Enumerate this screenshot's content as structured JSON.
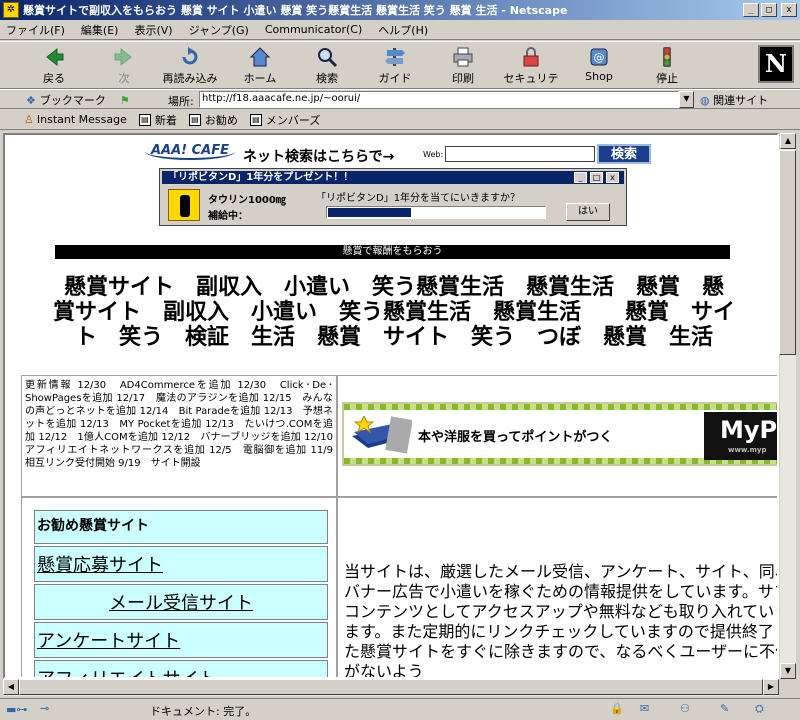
{
  "window": {
    "title": "懸賞サイトで副収入をもらおう 懸賞 サイト 小遣い 懸賞 笑う懸賞生活 懸賞生活 笑う 懸賞 生活 - Netscape",
    "minimize": "_",
    "maximize": "□",
    "close": "x"
  },
  "menu": [
    "ファイル(F)",
    "編集(E)",
    "表示(V)",
    "ジャンプ(G)",
    "Communicator(C)",
    "ヘルプ(H)"
  ],
  "toolbar": [
    {
      "label": "戻る",
      "icon": "back-icon"
    },
    {
      "label": "次",
      "icon": "forward-icon"
    },
    {
      "label": "再読み込み",
      "icon": "reload-icon"
    },
    {
      "label": "ホーム",
      "icon": "home-icon"
    },
    {
      "label": "検索",
      "icon": "search-icon"
    },
    {
      "label": "ガイド",
      "icon": "guide-icon"
    },
    {
      "label": "印刷",
      "icon": "print-icon"
    },
    {
      "label": "セキュリティ",
      "icon": "security-icon"
    },
    {
      "label": "Shop",
      "icon": "shop-icon"
    },
    {
      "label": "停止",
      "icon": "stop-icon"
    }
  ],
  "location": {
    "bookmarks": "ブックマーク",
    "label": "場所:",
    "url": "http://f18.aaacafe.ne.jp/~oorui/",
    "related": "関連サイト"
  },
  "personal": [
    "Instant Message",
    "新着",
    "お勧め",
    "メンバーズ"
  ],
  "page": {
    "cafe_logo": "AAA! CAFE",
    "netsearch": "ネット検索はこちらで→",
    "web_label": "Web:",
    "search_button": "検索",
    "popup": {
      "title": "「リポビタンD」1年分をプレゼント！！",
      "taurine": "タウリン1000㎎",
      "hokyu": "補給中：",
      "question": "「リポビタンD」1年分を当てにいきますか？",
      "progress": 0.38,
      "yes": "はい"
    },
    "blackbar": "懸賞で報酬をもらおう",
    "heading_lines": [
      "懸賞サイト　副収入　小遣い　笑う懸賞生活　懸賞生活　懸賞　懸",
      "賞サイト　副収入　小遣い　笑う懸賞生活　懸賞生活　　懸賞　サイ",
      "ト　笑う　検証　生活　懸賞　サイト　笑う　つぼ　懸賞　生活"
    ],
    "news": "更新情報 12/30　AD4Commerceを追加 12/30　Click･De･ShowPagesを追加 12/17　魔法のアラジンを追加 12/15　みんなの声どっとネットを追加 12/14　Bit Paradeを追加 12/13　予想ネットを追加 12/13　MY Pocketを追加 12/13　たいけつ.COMを追加 12/12　1億人COMを追加 12/12　バナーブリッジを追加 12/10　アフィリエイトネットワークスを追加 12/5　電脳御を追加 11/9　相互リンク受付開始 9/19　サイト開設",
    "banner_text": "本や洋服を買ってポイントがつく",
    "banner_brand": "MyPo",
    "banner_sub": "www.myp",
    "nav": [
      {
        "label": "お勧め懸賞サイト"
      },
      {
        "label": "懸賞応募サイト"
      },
      {
        "label": "メール受信サイト"
      },
      {
        "label": "アンケートサイト"
      },
      {
        "label": "アフィリエイトサイト"
      }
    ],
    "main_text": "当サイトは、厳選したメール受信、アンケート、サイト、同、バナー広告で小遣いを稼ぐための情報提供をしています。サブコンテンツとしてアクセスアップや無料なども取り入れていきます。また定期的にリンクチェックしていますので提供終了した懸賞サイトをすぐに除きますので、なるべくユーザーに不便がないよう"
  },
  "status": "ドキュメント: 完了。"
}
